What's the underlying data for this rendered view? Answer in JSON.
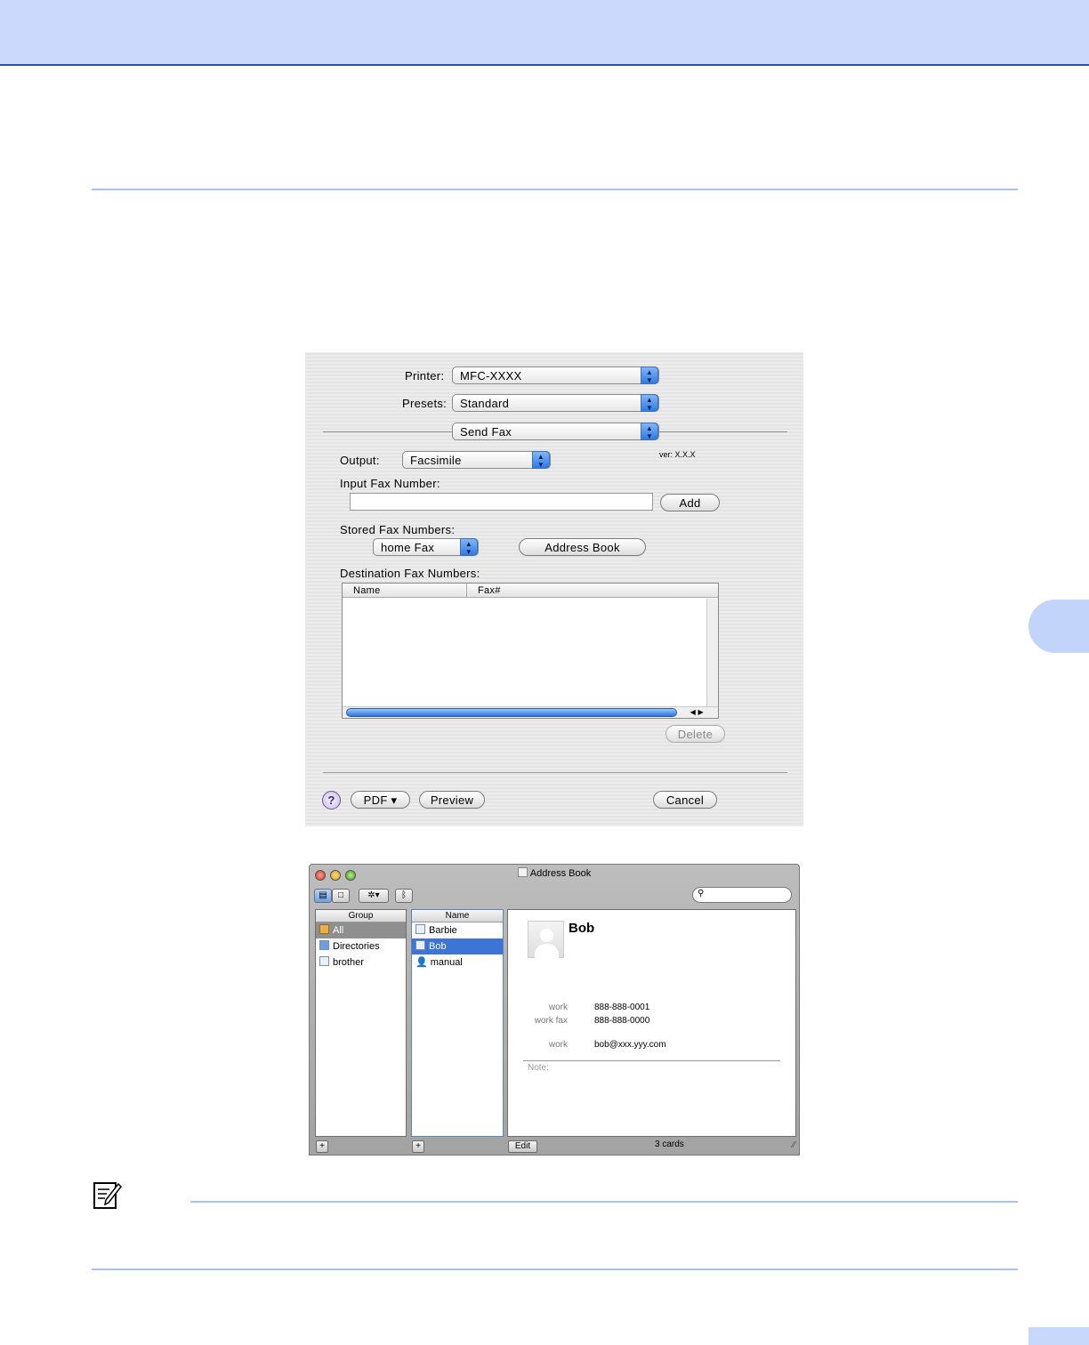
{
  "print_dialog": {
    "printer_label": "Printer:",
    "printer_value": "MFC-XXXX",
    "presets_label": "Presets:",
    "presets_value": "Standard",
    "panel_value": "Send Fax",
    "output_label": "Output:",
    "output_value": "Facsimile",
    "version": "ver: X.X.X",
    "input_fax_label": "Input Fax Number:",
    "input_fax_value": "",
    "add_button": "Add",
    "stored_label": "Stored Fax Numbers:",
    "stored_value": "home Fax",
    "address_book_button": "Address Book",
    "destination_label": "Destination Fax Numbers:",
    "table_columns": [
      "Name",
      "Fax#"
    ],
    "delete_button": "Delete",
    "help_glyph": "?",
    "pdf_button": "PDF ▾",
    "preview_button": "Preview",
    "cancel_button": "Cancel"
  },
  "address_book": {
    "title": "Address Book",
    "search_placeholder": "",
    "group_header": "Group",
    "name_header": "Name",
    "groups": [
      "All",
      "Directories",
      "brother"
    ],
    "names": [
      "Barbie",
      "Bob",
      "manual"
    ],
    "card_name": "Bob",
    "fields": [
      {
        "label": "work",
        "value": "888-888-0001"
      },
      {
        "label": "work fax",
        "value": "888-888-0000"
      },
      {
        "label": "work",
        "value": "bob@xxx.yyy.com"
      }
    ],
    "note_label": "Note:",
    "edit_button": "Edit",
    "card_count": "3 cards",
    "selected_group": "All",
    "selected_name": "Bob"
  },
  "colors": {
    "header_band": "#cad9fc",
    "rule": "#a9c2f2",
    "selection_blue": "#3d75d6",
    "popup_blue": "#2f7ae6"
  }
}
